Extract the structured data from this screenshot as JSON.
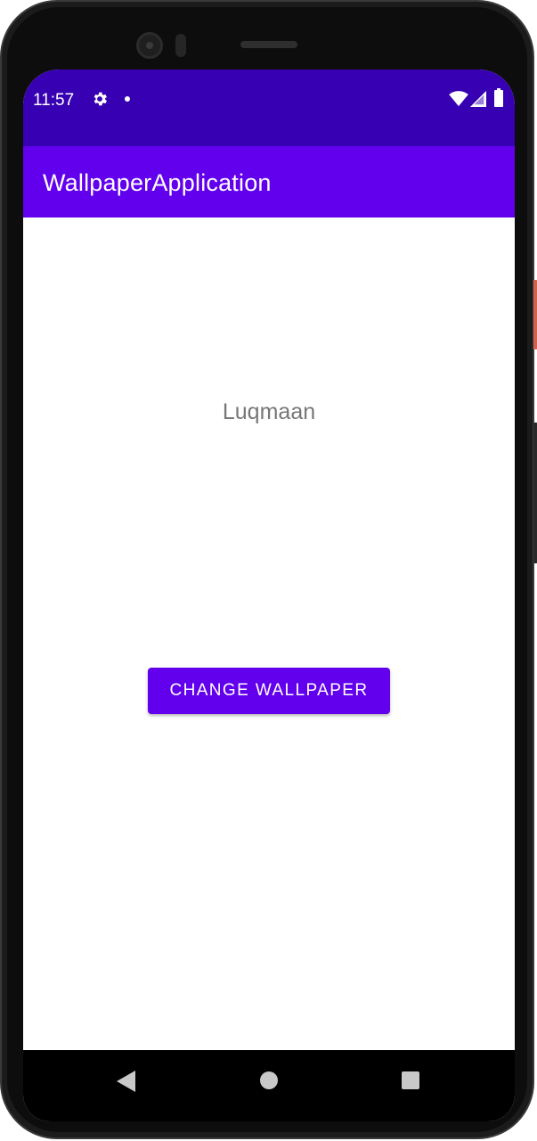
{
  "status_bar": {
    "time": "11:57",
    "icons": [
      "gear-icon",
      "notification-dot-icon",
      "wifi-icon",
      "signal-icon",
      "battery-icon"
    ]
  },
  "app_bar": {
    "title": "WallpaperApplication"
  },
  "main": {
    "name_text": "Luqmaan",
    "change_button_label": "CHANGE WALLPAPER"
  },
  "nav_bar": {
    "icons": [
      "back-icon",
      "home-icon",
      "recents-icon"
    ]
  },
  "colors": {
    "status_bar": "#3700b3",
    "app_bar": "#6200ee",
    "button": "#6200ee",
    "name_text": "#777777"
  }
}
